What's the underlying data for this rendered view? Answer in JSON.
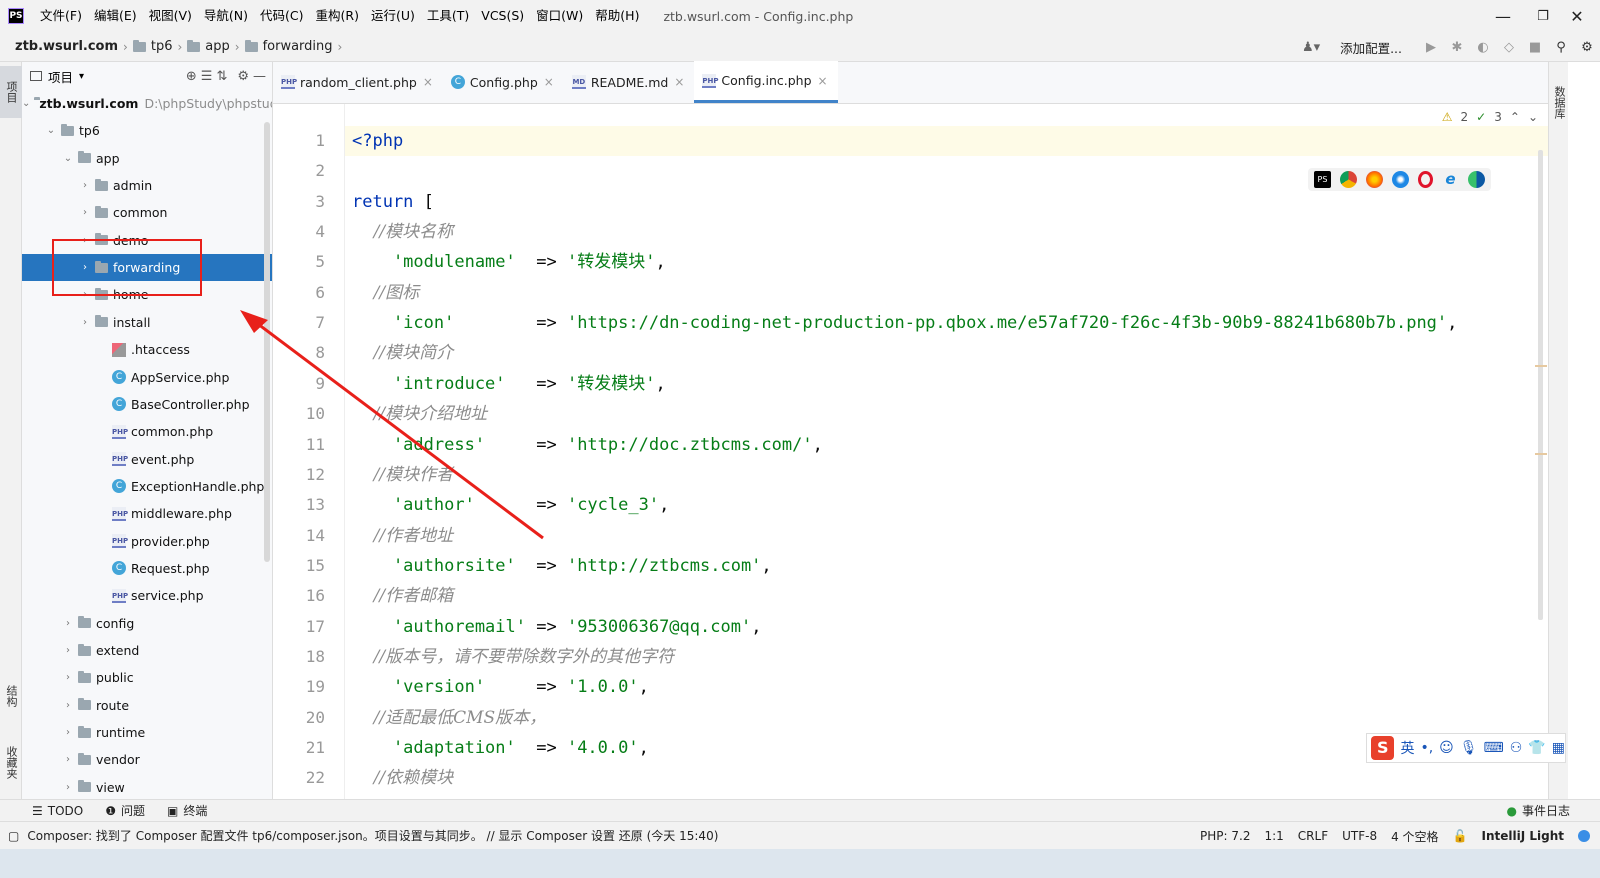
{
  "app": {
    "logo": "PS",
    "window_title": "ztb.wsurl.com - Config.inc.php"
  },
  "menu": [
    "文件(F)",
    "编辑(E)",
    "视图(V)",
    "导航(N)",
    "代码(C)",
    "重构(R)",
    "运行(U)",
    "工具(T)",
    "VCS(S)",
    "窗口(W)",
    "帮助(H)"
  ],
  "breadcrumb": [
    "ztb.wsurl.com",
    "tp6",
    "app",
    "forwarding"
  ],
  "toolbar": {
    "add_config": "添加配置..."
  },
  "left_strip": {
    "project": "项目",
    "structure": "结构",
    "favorites": "收藏夹"
  },
  "right_strip": {
    "database": "数据库"
  },
  "project_panel": {
    "title": "项目",
    "root_label": "ztb.wsurl.com",
    "root_path": "D:\\phpStudy\\phpstud",
    "items": [
      {
        "label": "tp6",
        "type": "folder"
      },
      {
        "label": "app",
        "type": "folder"
      },
      {
        "label": "admin",
        "type": "folder"
      },
      {
        "label": "common",
        "type": "folder"
      },
      {
        "label": "demo",
        "type": "folder"
      },
      {
        "label": "forwarding",
        "type": "folder",
        "selected": true
      },
      {
        "label": "home",
        "type": "folder"
      },
      {
        "label": "install",
        "type": "folder"
      },
      {
        "label": ".htaccess",
        "type": "htaccess"
      },
      {
        "label": "AppService.php",
        "type": "class"
      },
      {
        "label": "BaseController.php",
        "type": "class"
      },
      {
        "label": "common.php",
        "type": "php"
      },
      {
        "label": "event.php",
        "type": "php"
      },
      {
        "label": "ExceptionHandle.php",
        "type": "class"
      },
      {
        "label": "middleware.php",
        "type": "php"
      },
      {
        "label": "provider.php",
        "type": "php"
      },
      {
        "label": "Request.php",
        "type": "class"
      },
      {
        "label": "service.php",
        "type": "php"
      },
      {
        "label": "config",
        "type": "folder"
      },
      {
        "label": "extend",
        "type": "folder"
      },
      {
        "label": "public",
        "type": "folder"
      },
      {
        "label": "route",
        "type": "folder"
      },
      {
        "label": "runtime",
        "type": "folder"
      },
      {
        "label": "vendor",
        "type": "folder"
      },
      {
        "label": "view",
        "type": "folder"
      }
    ]
  },
  "editor_tabs": [
    {
      "label": "random_client.php",
      "icon": "PHP",
      "active": false
    },
    {
      "label": "Config.php",
      "icon": "C",
      "active": false
    },
    {
      "label": "README.md",
      "icon": "MD",
      "active": false
    },
    {
      "label": "Config.inc.php",
      "icon": "PHP",
      "active": true
    }
  ],
  "inspections": {
    "warnings": "2",
    "weak_warnings": "3"
  },
  "code_lines": [
    {
      "n": "1",
      "parts": [
        [
          "kw",
          "<?php"
        ]
      ]
    },
    {
      "n": "2",
      "parts": []
    },
    {
      "n": "3",
      "parts": [
        [
          "kw",
          "return"
        ],
        [
          "op",
          " ["
        ]
      ]
    },
    {
      "n": "4",
      "parts": [
        [
          "cmt",
          "    //模块名称"
        ]
      ]
    },
    {
      "n": "5",
      "parts": [
        [
          "str",
          "    'modulename'"
        ],
        [
          "op",
          "  => "
        ],
        [
          "str",
          "'转发模块'"
        ],
        [
          "op",
          ","
        ]
      ]
    },
    {
      "n": "6",
      "parts": [
        [
          "cmt",
          "    //图标"
        ]
      ]
    },
    {
      "n": "7",
      "parts": [
        [
          "str",
          "    'icon'"
        ],
        [
          "op",
          "        => "
        ],
        [
          "str",
          "'https://dn-coding-net-production-pp.qbox.me/e57af720-f26c-4f3b-90b9-88241b680b7b.png'"
        ],
        [
          "op",
          ","
        ]
      ]
    },
    {
      "n": "8",
      "parts": [
        [
          "cmt",
          "    //模块简介"
        ]
      ]
    },
    {
      "n": "9",
      "parts": [
        [
          "str",
          "    'introduce'"
        ],
        [
          "op",
          "   => "
        ],
        [
          "str",
          "'转发模块'"
        ],
        [
          "op",
          ","
        ]
      ]
    },
    {
      "n": "10",
      "parts": [
        [
          "cmt",
          "    //模块介绍地址"
        ]
      ]
    },
    {
      "n": "11",
      "parts": [
        [
          "str",
          "    'address'"
        ],
        [
          "op",
          "     => "
        ],
        [
          "str",
          "'http://doc.ztbcms.com/'"
        ],
        [
          "op",
          ","
        ]
      ]
    },
    {
      "n": "12",
      "parts": [
        [
          "cmt",
          "    //模块作者"
        ]
      ]
    },
    {
      "n": "13",
      "parts": [
        [
          "str",
          "    'author'"
        ],
        [
          "op",
          "      => "
        ],
        [
          "str",
          "'cycle_3'"
        ],
        [
          "op",
          ","
        ]
      ]
    },
    {
      "n": "14",
      "parts": [
        [
          "cmt",
          "    //作者地址"
        ]
      ]
    },
    {
      "n": "15",
      "parts": [
        [
          "str",
          "    'authorsite'"
        ],
        [
          "op",
          "  => "
        ],
        [
          "str",
          "'http://ztbcms.com'"
        ],
        [
          "op",
          ","
        ]
      ]
    },
    {
      "n": "16",
      "parts": [
        [
          "cmt",
          "    //作者邮箱"
        ]
      ]
    },
    {
      "n": "17",
      "parts": [
        [
          "str",
          "    'authoremail'"
        ],
        [
          "op",
          " => "
        ],
        [
          "str",
          "'953006367@qq.com'"
        ],
        [
          "op",
          ","
        ]
      ]
    },
    {
      "n": "18",
      "parts": [
        [
          "cmt",
          "    //版本号，请不要带除数字外的其他字符"
        ]
      ]
    },
    {
      "n": "19",
      "parts": [
        [
          "str",
          "    'version'"
        ],
        [
          "op",
          "     => "
        ],
        [
          "str",
          "'1.0.0'"
        ],
        [
          "op",
          ","
        ]
      ]
    },
    {
      "n": "20",
      "parts": [
        [
          "cmt",
          "    //适配最低CMS版本，"
        ]
      ]
    },
    {
      "n": "21",
      "parts": [
        [
          "str",
          "    'adaptation'"
        ],
        [
          "op",
          "  => "
        ],
        [
          "str",
          "'4.0.0'"
        ],
        [
          "op",
          ","
        ]
      ]
    },
    {
      "n": "22",
      "parts": [
        [
          "cmt",
          "    //依赖模块"
        ]
      ]
    }
  ],
  "bottom_tools": {
    "todo": "TODO",
    "problems": "问题",
    "terminal": "终端",
    "event_log": "事件日志"
  },
  "status": {
    "message": "Composer: 找到了 Composer 配置文件 tp6/composer.json。项目设置与其同步。 // 显示 Composer 设置   还原 (今天 15:40)",
    "php_version": "PHP: 7.2",
    "position": "1:1",
    "line_sep": "CRLF",
    "encoding": "UTF-8",
    "indent": "4 个空格",
    "theme": "IntelliJ Light"
  },
  "ime": {
    "lang": "英"
  },
  "colors": {
    "selection": "#2675bf",
    "annotation": "#e8201a",
    "keyword": "#0033b3",
    "string": "#067d17",
    "comment": "#8c8c8c"
  }
}
